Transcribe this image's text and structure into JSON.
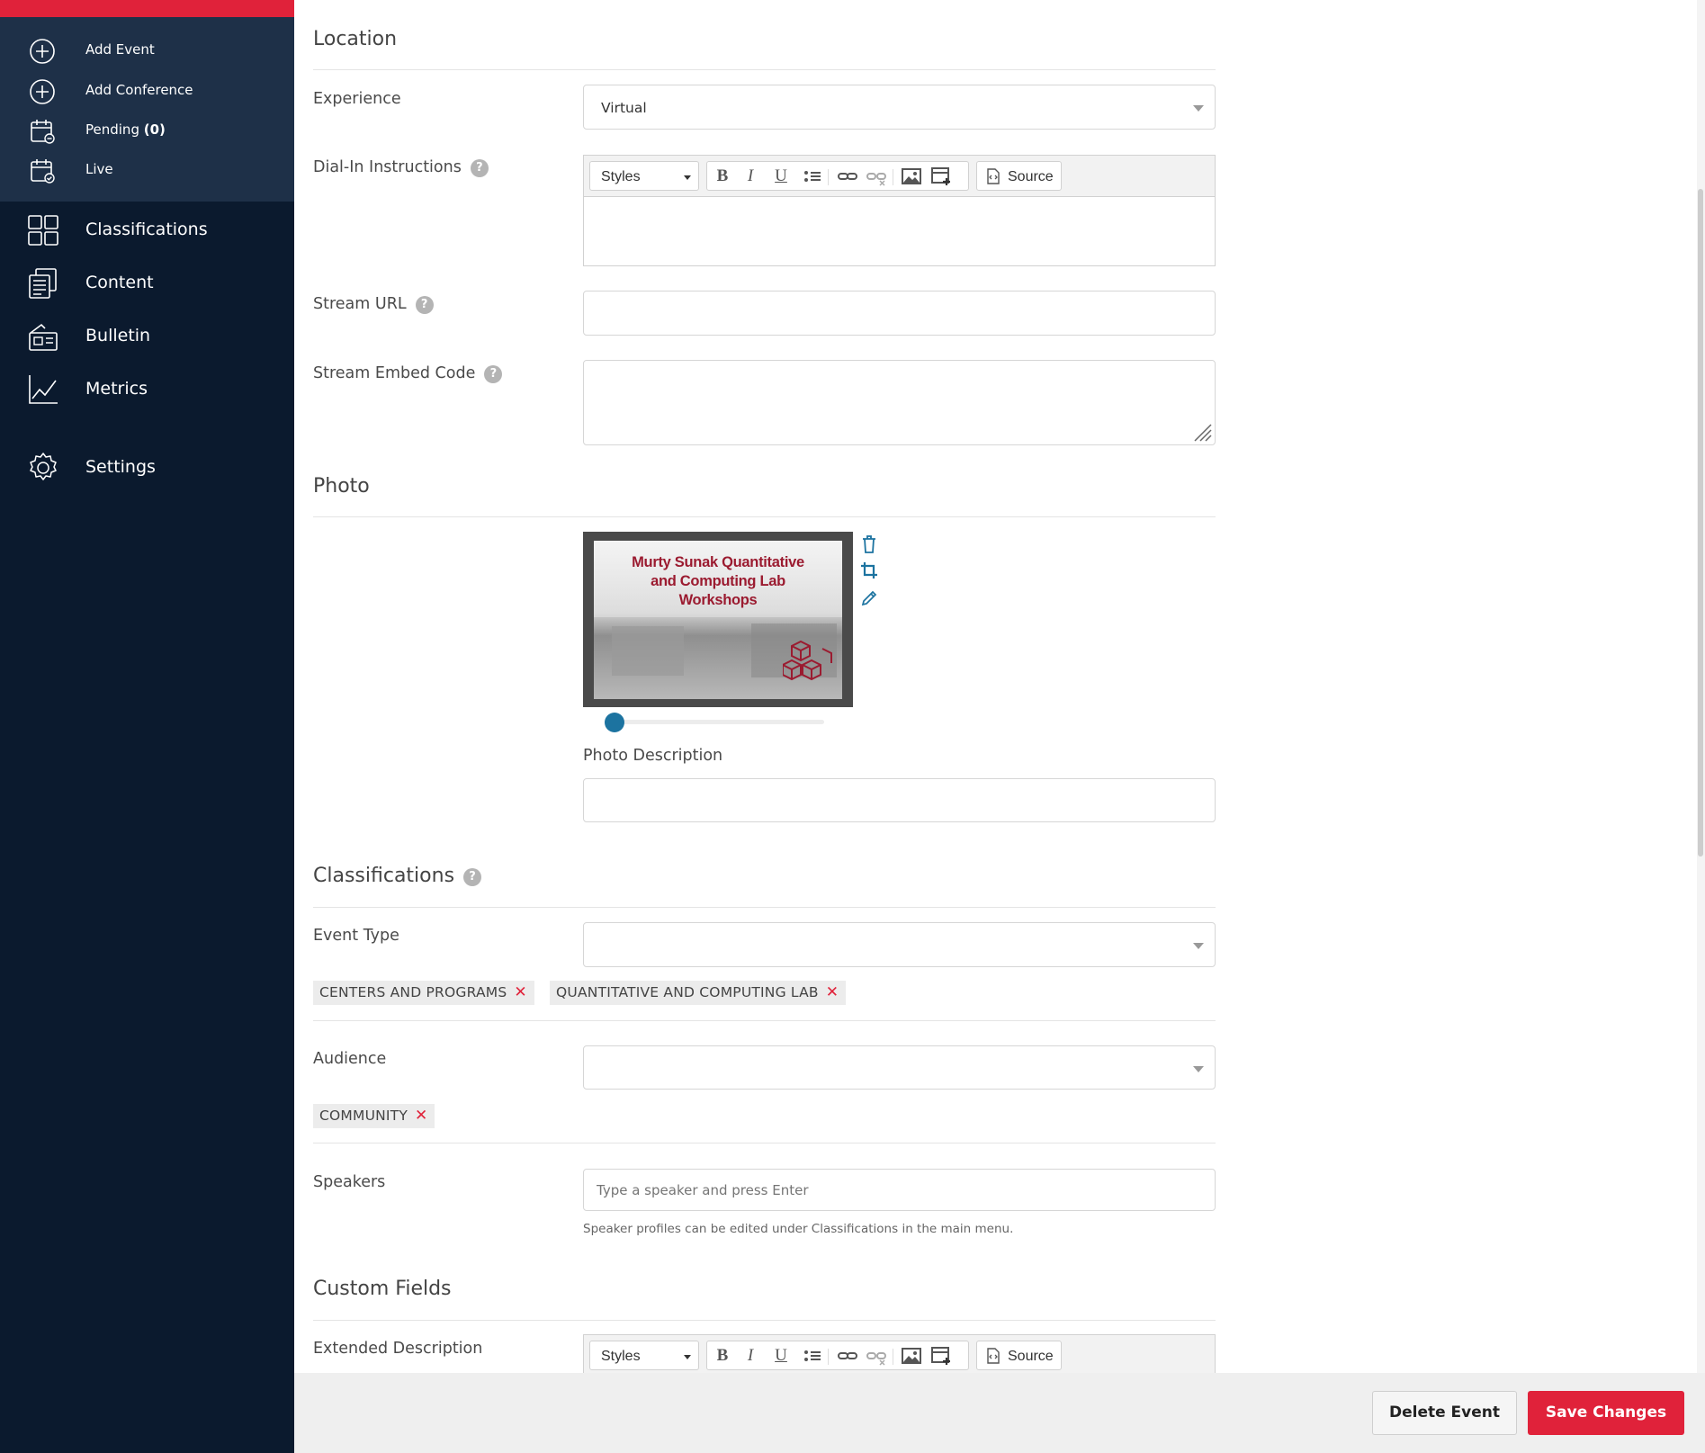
{
  "sidebar": {
    "sub_items": [
      {
        "label": "Add Event",
        "icon": "plus-circle-icon"
      },
      {
        "label": "Add Conference",
        "icon": "plus-circle-icon"
      },
      {
        "label": "Pending",
        "count": "(0)",
        "icon": "calendar-pending-icon"
      },
      {
        "label": "Live",
        "icon": "calendar-check-icon"
      }
    ],
    "items": [
      {
        "label": "Classifications",
        "icon": "grid-icon"
      },
      {
        "label": "Content",
        "icon": "documents-icon"
      },
      {
        "label": "Bulletin",
        "icon": "bulletin-icon"
      },
      {
        "label": "Metrics",
        "icon": "chart-line-icon"
      },
      {
        "label": "Settings",
        "icon": "gear-icon"
      }
    ]
  },
  "location": {
    "title": "Location",
    "experience_label": "Experience",
    "experience_value": "Virtual",
    "dial_in_label": "Dial-In Instructions",
    "stream_url_label": "Stream URL",
    "stream_embed_label": "Stream Embed Code"
  },
  "editor": {
    "styles_label": "Styles",
    "source_label": "Source"
  },
  "photo": {
    "title": "Photo",
    "image_text": "Murty Sunak Quantitative and Computing Lab Workshops",
    "image_lines": [
      "Murty Sunak Quantitative",
      "and Computing Lab",
      "Workshops"
    ],
    "description_label": "Photo Description",
    "description_value": "",
    "zoom_level": 0
  },
  "classifications": {
    "title": "Classifications",
    "event_type_label": "Event Type",
    "event_type_tags": [
      "CENTERS AND PROGRAMS",
      "QUANTITATIVE AND COMPUTING LAB"
    ],
    "audience_label": "Audience",
    "audience_tags": [
      "COMMUNITY"
    ],
    "speakers_label": "Speakers",
    "speakers_placeholder": "Type a speaker and press Enter",
    "speakers_hint": "Speaker profiles can be edited under Classifications in the main menu."
  },
  "custom_fields": {
    "title": "Custom Fields",
    "extended_description_label": "Extended Description"
  },
  "footer": {
    "delete_label": "Delete Event",
    "save_label": "Save Changes"
  },
  "colors": {
    "brand_red": "#e0223a",
    "sidebar_bg": "#0b1a2e",
    "subnav_bg": "#1e3048",
    "accent_blue": "#1c73a0"
  }
}
